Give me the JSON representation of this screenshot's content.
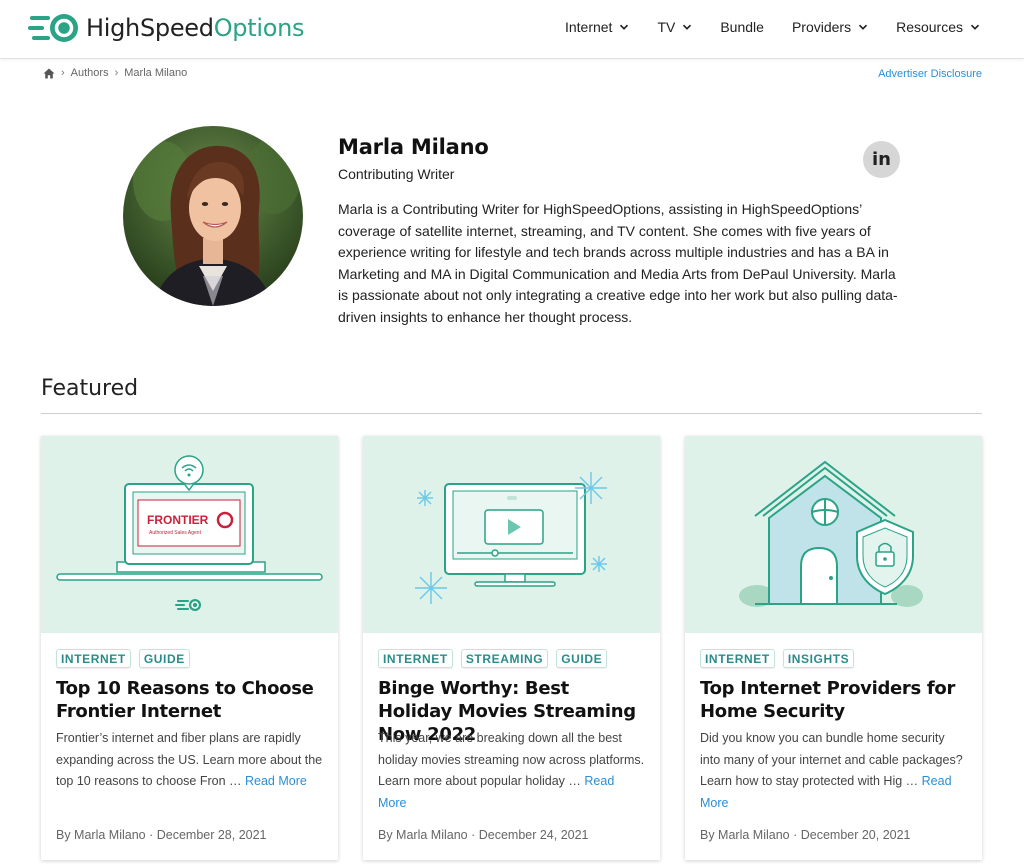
{
  "brand": {
    "name_part1": "HighSpeed",
    "name_part2": "Options",
    "accent": "#2aa387"
  },
  "nav": {
    "items": [
      {
        "label": "Internet",
        "has_dropdown": true
      },
      {
        "label": "TV",
        "has_dropdown": true
      },
      {
        "label": "Bundle",
        "has_dropdown": false
      },
      {
        "label": "Providers",
        "has_dropdown": true
      },
      {
        "label": "Resources",
        "has_dropdown": true
      }
    ]
  },
  "breadcrumb": {
    "home_icon": "home-icon",
    "items": [
      "Authors",
      "Marla Milano"
    ]
  },
  "disclosure": "Advertiser Disclosure",
  "author": {
    "name": "Marla Milano",
    "role": "Contributing Writer",
    "bio": "Marla is a Contributing Writer for HighSpeedOptions, assisting in HighSpeedOptions’ coverage of satellite internet, streaming, and TV content. She comes with five years of experience writing for lifestyle and tech brands across multiple industries and has a BA in Marketing and MA in Digital Communication and Media Arts from DePaul University. Marla is passionate about not only integrating a creative edge into her work but also pulling data-driven insights to enhance her thought process.",
    "social": "in"
  },
  "featured": {
    "heading": "Featured",
    "cards": [
      {
        "tags": [
          "INTERNET",
          "GUIDE"
        ],
        "title": "Top 10 Reasons to Choose Frontier Internet",
        "excerpt": "Frontier’s internet and fiber plans are rapidly expanding across the US. Learn more about the top 10 reasons to choose Fron … ",
        "read_more": "Read More",
        "byline": "By Marla Milano · December 28, 2021",
        "image_text": {
          "brand": "FRONTIER",
          "sub": "Authorized Sales Agent"
        }
      },
      {
        "tags": [
          "INTERNET",
          "STREAMING",
          "GUIDE"
        ],
        "title": "Binge Worthy: Best Holiday Movies Streaming Now 2022",
        "excerpt": "This year, we are breaking down all the best holiday movies streaming now across platforms. Learn more about popular holiday … ",
        "read_more": "Read More",
        "byline": "By Marla Milano · December 24, 2021"
      },
      {
        "tags": [
          "INTERNET",
          "INSIGHTS"
        ],
        "title": "Top Internet Providers for Home Security",
        "excerpt": "Did you know you can bundle home security into many of your internet and cable packages? Learn how to stay protected with Hig … ",
        "read_more": "Read More",
        "byline": "By Marla Milano · December 20, 2021"
      }
    ]
  }
}
